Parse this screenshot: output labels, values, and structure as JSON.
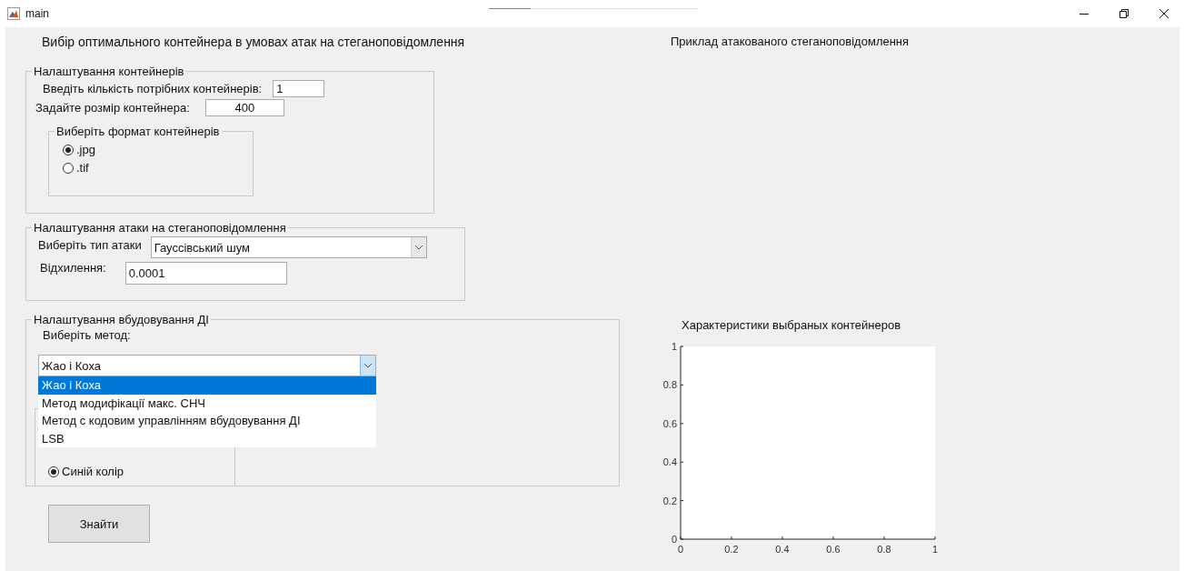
{
  "window": {
    "title": "main"
  },
  "loading_bar": {
    "level": 0.2
  },
  "main_title": "Вибір оптимального контейнера в умовах атак на стеганоповідомлення",
  "container_panel": {
    "title": "Налаштування контейнерів",
    "count_label": "Введіть кількість потрібних контейнерів:",
    "count_value": "1",
    "size_label": "Задайте розмір контейнера:",
    "size_value": "400",
    "format_group": {
      "title": "Виберіть формат контейнерів",
      "options": [
        {
          "label": ".jpg",
          "selected": true
        },
        {
          "label": ".tif",
          "selected": false
        }
      ]
    }
  },
  "attack_panel": {
    "title": "Налаштування атаки на стеганоповідомлення",
    "type_label": "Виберіть тип атаки",
    "type_value": "Гауссівський шум",
    "deviation_label": "Відхилення:",
    "deviation_value": "0.0001"
  },
  "embed_panel": {
    "title": "Налаштування вбудовування ДІ",
    "method_label": "Виберіть метод:",
    "method_value": "Жао і Коха",
    "expanded": true,
    "options": [
      {
        "label": "Жао і Коха",
        "selected": true
      },
      {
        "label": "Метод модифікації макс. СНЧ",
        "selected": false
      },
      {
        "label": "Метод с кодовим управлінням вбудовування ДІ",
        "selected": false
      },
      {
        "label": "LSB",
        "selected": false
      }
    ],
    "color_options": [
      {
        "label": "Синій колір",
        "selected": true
      }
    ]
  },
  "find_button": "Знайти",
  "preview_title": "Приклад атакованого стеганоповідомлення",
  "chart": {
    "chart_data": {
      "type": "line",
      "title": "Характеристики выбраных контейнеров",
      "xlim": [
        0,
        1
      ],
      "ylim": [
        0,
        1
      ],
      "xticks": [
        0,
        0.2,
        0.4,
        0.6,
        0.8,
        1
      ],
      "yticks": [
        0,
        0.2,
        0.4,
        0.6,
        0.8,
        1
      ]
    }
  }
}
